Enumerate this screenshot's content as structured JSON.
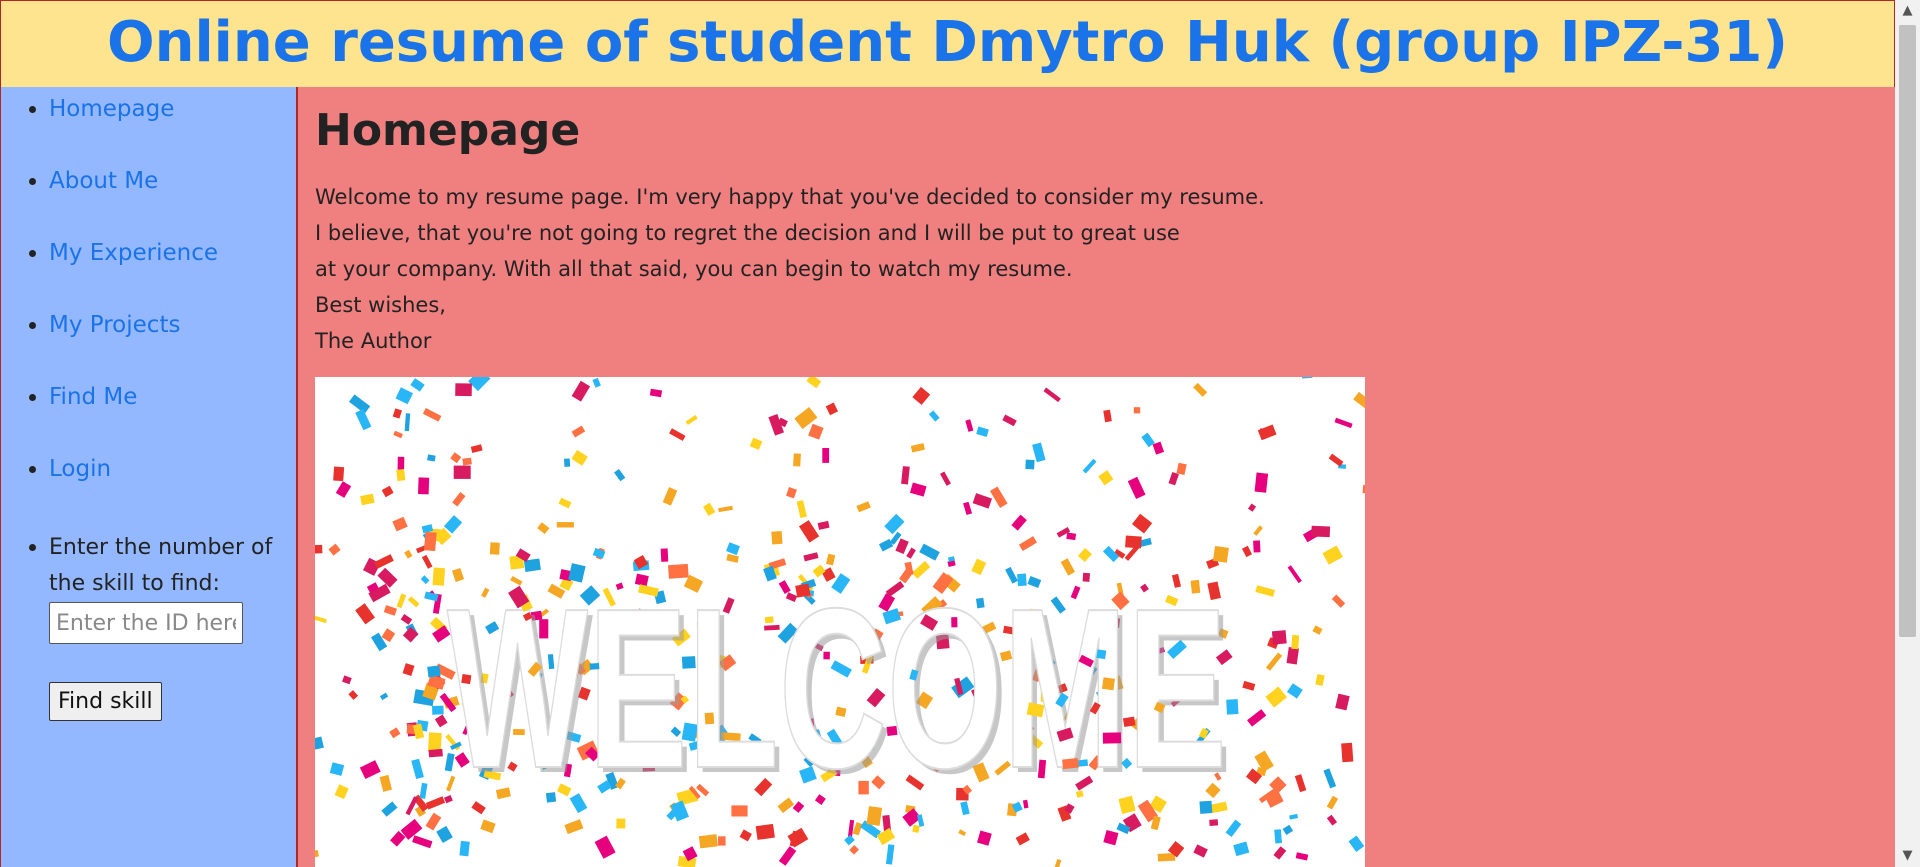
{
  "header": {
    "title": "Online resume of student Dmytro Huk (group IPZ-31)"
  },
  "sidebar": {
    "items": [
      {
        "label": "Homepage"
      },
      {
        "label": "About Me"
      },
      {
        "label": "My Experience"
      },
      {
        "label": "My Projects"
      },
      {
        "label": "Find Me"
      },
      {
        "label": "Login"
      }
    ],
    "search": {
      "label": "Enter the number of the skill to find:",
      "placeholder": "Enter the ID here",
      "value": "",
      "button_label": "Find skill"
    }
  },
  "main": {
    "heading": "Homepage",
    "paragraph_lines": [
      "Welcome to my resume page. I'm very happy that you've decided to consider my resume.",
      "I believe, that you're not going to regret the decision and I will be put to great use",
      "at your company. With all that said, you can begin to watch my resume.",
      "Best wishes,",
      "The Author"
    ],
    "image": {
      "text": "WELCOME",
      "icon": "welcome-confetti-image"
    }
  },
  "colors": {
    "header_bg": "#ffe48f",
    "title": "#1a73e8",
    "sidebar_bg": "#94b8ff",
    "main_bg": "#f08080",
    "border": "#b32626",
    "link": "#1a73e8"
  },
  "scrollbar": {
    "up_icon": "chevron-up-icon",
    "down_icon": "chevron-down-icon"
  }
}
